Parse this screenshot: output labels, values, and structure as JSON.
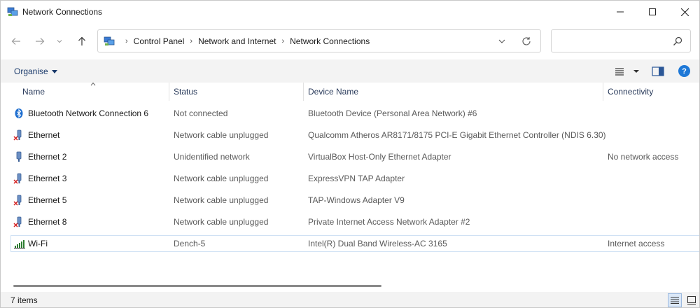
{
  "window": {
    "title": "Network Connections",
    "app_icon": "network-connections-icon"
  },
  "address": {
    "crumbs": [
      "Control Panel",
      "Network and Internet",
      "Network Connections"
    ],
    "search_placeholder": ""
  },
  "toolbar": {
    "organise_label": "Organise",
    "help_label": "?"
  },
  "columns": {
    "name": "Name",
    "status": "Status",
    "device": "Device Name",
    "connectivity": "Connectivity"
  },
  "connections": [
    {
      "name": "Bluetooth Network Connection 6",
      "status": "Not connected",
      "device": "Bluetooth Device (Personal Area Network) #6",
      "connectivity": "",
      "icon": "bluetooth-icon"
    },
    {
      "name": "Ethernet",
      "status": "Network cable unplugged",
      "device": "Qualcomm Atheros AR8171/8175 PCI-E Gigabit Ethernet Controller (NDIS 6.30)",
      "connectivity": "",
      "icon": "ethernet-unplugged-icon"
    },
    {
      "name": "Ethernet 2",
      "status": "Unidentified network",
      "device": "VirtualBox Host-Only Ethernet Adapter",
      "connectivity": "No network access",
      "icon": "ethernet-icon"
    },
    {
      "name": "Ethernet 3",
      "status": "Network cable unplugged",
      "device": "ExpressVPN TAP Adapter",
      "connectivity": "",
      "icon": "ethernet-unplugged-icon"
    },
    {
      "name": "Ethernet 5",
      "status": "Network cable unplugged",
      "device": "TAP-Windows Adapter V9",
      "connectivity": "",
      "icon": "ethernet-unplugged-icon"
    },
    {
      "name": "Ethernet 8",
      "status": "Network cable unplugged",
      "device": "Private Internet Access Network Adapter #2",
      "connectivity": "",
      "icon": "ethernet-unplugged-icon"
    },
    {
      "name": "Wi-Fi",
      "status": "Dench-5",
      "device": "Intel(R) Dual Band Wireless-AC 3165",
      "connectivity": "Internet access",
      "icon": "wifi-signal-icon"
    }
  ],
  "status": {
    "item_count": "7 items"
  },
  "colors": {
    "accent": "#1e78d7",
    "selection_border": "#cfe1f4",
    "toolbar_bg": "#f3f3f3"
  }
}
